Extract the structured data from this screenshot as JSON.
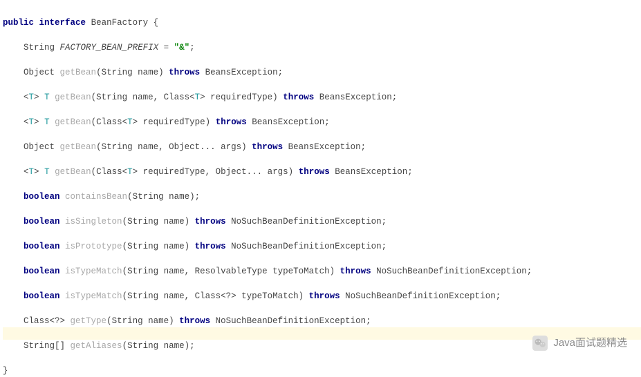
{
  "code": {
    "l1": {
      "kw1": "public",
      "kw2": "interface",
      "name": "BeanFactory",
      "brace": " {"
    },
    "l2": {
      "type": "String",
      "field": "FACTORY_BEAN_PREFIX",
      "eq": " = ",
      "str": "\"&\"",
      "end": ";"
    },
    "l3": {
      "type": "Object",
      "m": "getBean",
      "p": "(String name)",
      "thr": "throws",
      "exc": "BeansException;"
    },
    "l4": {
      "g1": "<",
      "tp1": "T",
      "g2": "> ",
      "tp2": "T",
      "sp": " ",
      "m": "getBean",
      "p1": "(String name, Class<",
      "tp3": "T",
      "p2": "> requiredType)",
      "thr": "throws",
      "exc": "BeansException;"
    },
    "l5": {
      "g1": "<",
      "tp1": "T",
      "g2": "> ",
      "tp2": "T",
      "sp": " ",
      "m": "getBean",
      "p1": "(Class<",
      "tp3": "T",
      "p2": "> requiredType)",
      "thr": "throws",
      "exc": "BeansException;"
    },
    "l6": {
      "type": "Object",
      "m": "getBean",
      "p": "(String name, Object... args)",
      "thr": "throws",
      "exc": "BeansException;"
    },
    "l7": {
      "g1": "<",
      "tp1": "T",
      "g2": "> ",
      "tp2": "T",
      "sp": " ",
      "m": "getBean",
      "p1": "(Class<",
      "tp3": "T",
      "p2": "> requiredType, Object... args)",
      "thr": "throws",
      "exc": "BeansException;"
    },
    "l8": {
      "kw": "boolean",
      "m": "containsBean",
      "p": "(String name);"
    },
    "l9": {
      "kw": "boolean",
      "m": "isSingleton",
      "p": "(String name)",
      "thr": "throws",
      "exc": "NoSuchBeanDefinitionException;"
    },
    "l10": {
      "kw": "boolean",
      "m": "isPrototype",
      "p": "(String name)",
      "thr": "throws",
      "exc": "NoSuchBeanDefinitionException;"
    },
    "l11": {
      "kw": "boolean",
      "m": "isTypeMatch",
      "p": "(String name, ResolvableType typeToMatch)",
      "thr": "throws",
      "exc": "NoSuchBeanDefinitionException;"
    },
    "l12": {
      "kw": "boolean",
      "m": "isTypeMatch",
      "p": "(String name, Class<?> typeToMatch)",
      "thr": "throws",
      "exc": "NoSuchBeanDefinitionException;"
    },
    "l13": {
      "type": "Class<?>",
      "m": "getType",
      "p": "(String name)",
      "thr": "throws",
      "exc": "NoSuchBeanDefinitionException;"
    },
    "l14": {
      "type": "String[]",
      "m": "getAliases",
      "p": "(String name);"
    },
    "close": "}"
  },
  "watermark": {
    "text": "Java面试题精选"
  }
}
